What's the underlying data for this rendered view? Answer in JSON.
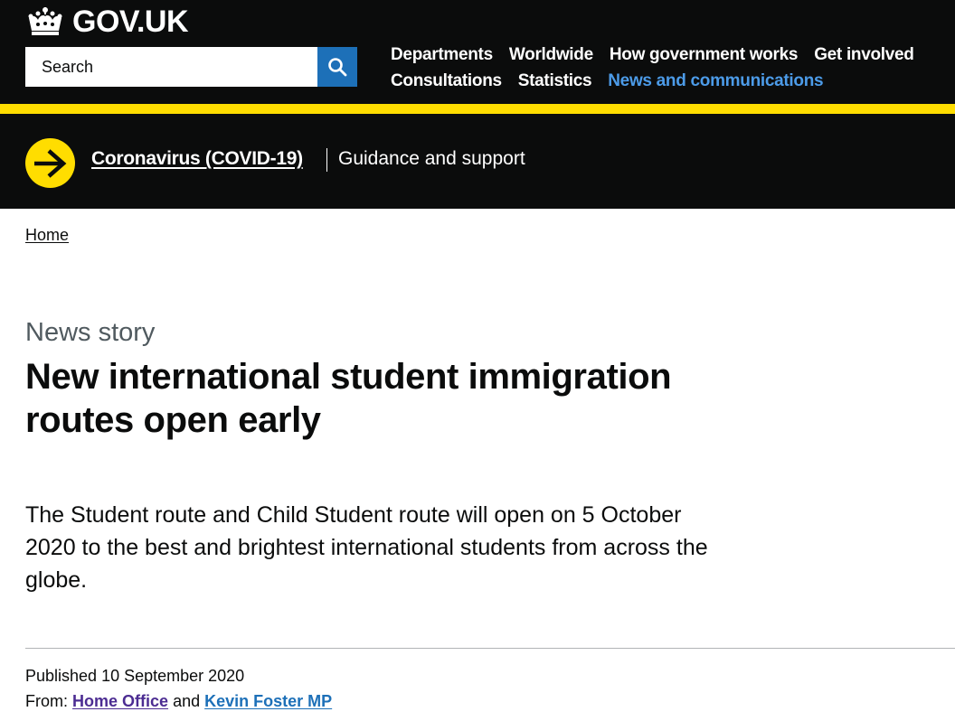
{
  "header": {
    "logo_text": "GOV.UK",
    "search": {
      "placeholder": "Search",
      "value": ""
    },
    "nav": {
      "row1": [
        "Departments",
        "Worldwide",
        "How government works",
        "Get involved"
      ],
      "row2": [
        "Consultations",
        "Statistics",
        "News and communications"
      ],
      "active": "News and communications"
    }
  },
  "colors": {
    "header_bg": "#0b0c0c",
    "accent_yellow": "#ffdd00",
    "link_blue": "#1d70b8",
    "nav_active": "#4c9be8",
    "visited_purple": "#4c2c92"
  },
  "covid_banner": {
    "icon": "arrow-right-icon",
    "link_text": "Coronavirus (COVID-19)",
    "guidance_text": "Guidance and support"
  },
  "breadcrumb": {
    "home": "Home"
  },
  "article": {
    "caption": "News story",
    "title": "New international student immigration routes open early",
    "lead": "The Student route and Child Student route will open on 5 October 2020 to the best and brightest international students from across the globe.",
    "published_label": "Published",
    "published_date": "10 September 2020",
    "from_label": "From:",
    "from_org": "Home Office",
    "from_and": "and",
    "from_person": "Kevin Foster MP"
  }
}
